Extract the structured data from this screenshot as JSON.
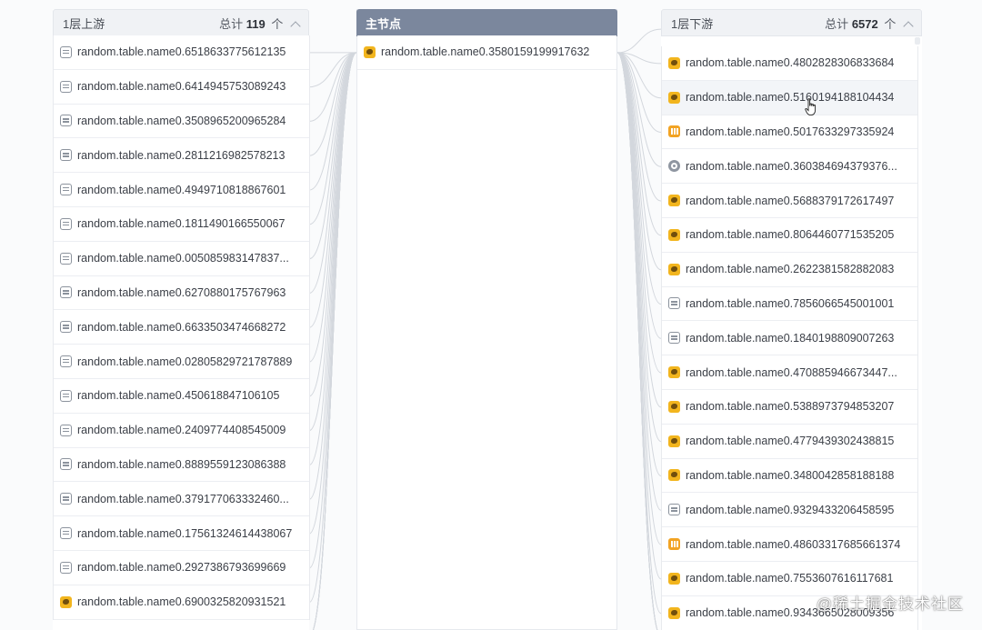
{
  "upstream": {
    "title": "1层上游",
    "total_label": "总计",
    "total_count": "119",
    "unit": "个",
    "items": [
      {
        "icon": "table",
        "label": "random.table.name0.6518633775612135"
      },
      {
        "icon": "table",
        "label": "random.table.name0.6414945753089243"
      },
      {
        "icon": "table",
        "label": "random.table.name0.3508965200965284"
      },
      {
        "icon": "table",
        "label": "random.table.name0.2811216982578213"
      },
      {
        "icon": "table",
        "label": "random.table.name0.4949710818867601"
      },
      {
        "icon": "table",
        "label": "random.table.name0.1811490166550067"
      },
      {
        "icon": "table",
        "label": "random.table.name0.005085983147837..."
      },
      {
        "icon": "table",
        "label": "random.table.name0.6270880175767963"
      },
      {
        "icon": "table",
        "label": "random.table.name0.6633503474668272"
      },
      {
        "icon": "table",
        "label": "random.table.name0.02805829721787889"
      },
      {
        "icon": "table",
        "label": "random.table.name0.450618847106105"
      },
      {
        "icon": "table",
        "label": "random.table.name0.2409774408545009"
      },
      {
        "icon": "table",
        "label": "random.table.name0.8889559123086388"
      },
      {
        "icon": "table",
        "label": "random.table.name0.379177063332460..."
      },
      {
        "icon": "table",
        "label": "random.table.name0.17561324614438067"
      },
      {
        "icon": "table",
        "label": "random.table.name0.2927386793699669"
      },
      {
        "icon": "hive",
        "label": "random.table.name0.6900325820931521"
      }
    ]
  },
  "main_node": {
    "title": "主节点",
    "item": {
      "icon": "hive",
      "label": "random.table.name0.3580159199917632"
    }
  },
  "downstream": {
    "title": "1层下游",
    "total_label": "总计",
    "total_count": "6572",
    "unit": "个",
    "items": [
      {
        "icon": "hive",
        "label": "random.table.name0.4802828306833684"
      },
      {
        "icon": "hive",
        "label": "random.table.name0.5160194188104434"
      },
      {
        "icon": "stream",
        "label": "random.table.name0.5017633297335924"
      },
      {
        "icon": "db",
        "label": "random.table.name0.360384694379376..."
      },
      {
        "icon": "hive",
        "label": "random.table.name0.5688379172617497"
      },
      {
        "icon": "hive",
        "label": "random.table.name0.8064460771535205"
      },
      {
        "icon": "hive",
        "label": "random.table.name0.2622381582882083"
      },
      {
        "icon": "table",
        "label": "random.table.name0.7856066545001001"
      },
      {
        "icon": "table",
        "label": "random.table.name0.1840198809007263"
      },
      {
        "icon": "hive",
        "label": "random.table.name0.470885946673447..."
      },
      {
        "icon": "hive",
        "label": "random.table.name0.5388973794853207"
      },
      {
        "icon": "hive",
        "label": "random.table.name0.4779439302438815"
      },
      {
        "icon": "hive",
        "label": "random.table.name0.3480042858188188"
      },
      {
        "icon": "table",
        "label": "random.table.name0.9329433206458595"
      },
      {
        "icon": "stream",
        "label": "random.table.name0.48603317685661374"
      },
      {
        "icon": "hive",
        "label": "random.table.name0.7553607616117681"
      },
      {
        "icon": "hive",
        "label": "random.table.name0.9343665028009356"
      }
    ]
  },
  "watermark": "@稀土掘金技术社区",
  "colors": {
    "main_header": "#7b879d",
    "hive_icon": "#f2b51e",
    "stream_icon": "#f2a323",
    "table_icon": "#8c939d",
    "link_line": "#d3d7dd"
  }
}
